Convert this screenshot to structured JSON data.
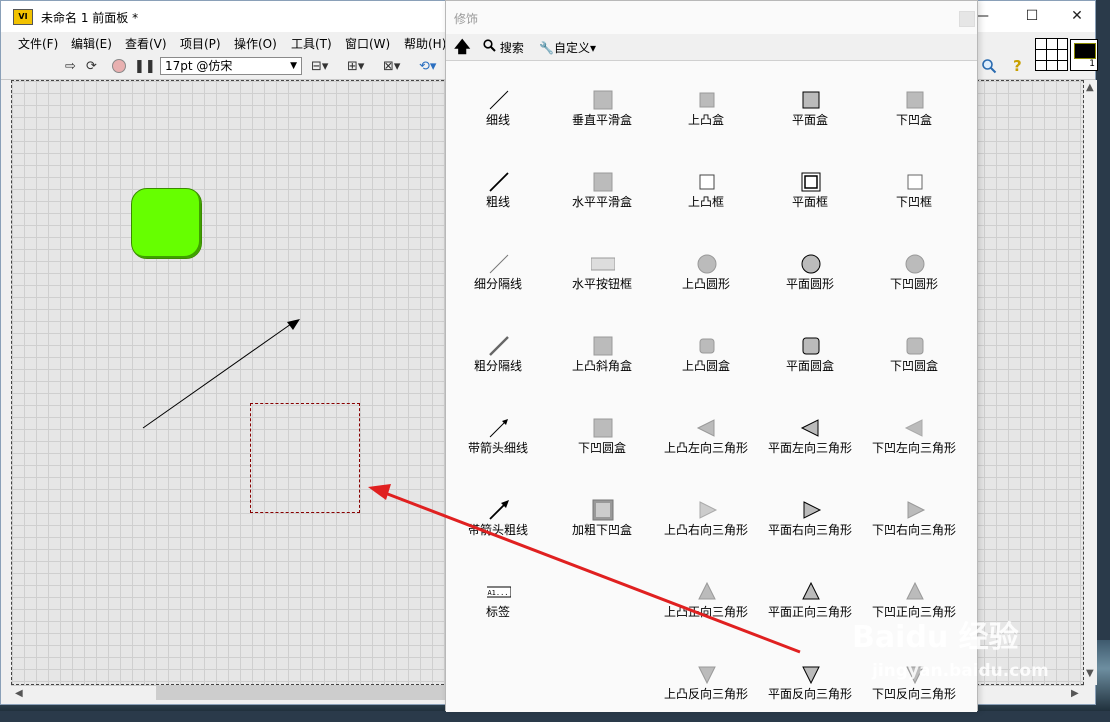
{
  "window": {
    "title": "未命名 1 前面板 *",
    "app_icon_text": "VI",
    "minimize": "—",
    "maximize": "☐",
    "close": "✕"
  },
  "menu": [
    "文件(F)",
    "编辑(E)",
    "查看(V)",
    "项目(P)",
    "操作(O)",
    "工具(T)",
    "窗口(W)",
    "帮助(H)"
  ],
  "toolbar": {
    "font": "17pt @仿宋",
    "help_glyph": "?"
  },
  "vi_icon_number": "1",
  "palette": {
    "title": "修饰",
    "search": "搜索",
    "customize": "自定义",
    "items": [
      [
        "细线",
        "垂直平滑盒",
        "上凸盒",
        "平面盒",
        "下凹盒"
      ],
      [
        "粗线",
        "水平平滑盒",
        "上凸框",
        "平面框",
        "下凹框"
      ],
      [
        "细分隔线",
        "水平按钮框",
        "上凸圆形",
        "平面圆形",
        "下凹圆形"
      ],
      [
        "粗分隔线",
        "上凸斜角盒",
        "上凸圆盒",
        "平面圆盒",
        "下凹圆盒"
      ],
      [
        "带箭头细线",
        "下凹圆盒",
        "上凸左向三角形",
        "平面左向三角形",
        "下凹左向三角形"
      ],
      [
        "带箭头粗线",
        "加粗下凹盒",
        "上凸右向三角形",
        "平面右向三角形",
        "下凹右向三角形"
      ],
      [
        "标签",
        "",
        "上凸正向三角形",
        "平面正向三角形",
        "下凹正向三角形"
      ],
      [
        "",
        "",
        "上凸反向三角形",
        "平面反向三角形",
        "下凹反向三角形"
      ]
    ],
    "label_icon_text": "A1..."
  },
  "watermark": {
    "brand": "Baidu 经验",
    "url": "jingyan.baidu.com"
  },
  "colors": {
    "green_control": "#66ff00",
    "annotation_arrow": "#e02020"
  }
}
